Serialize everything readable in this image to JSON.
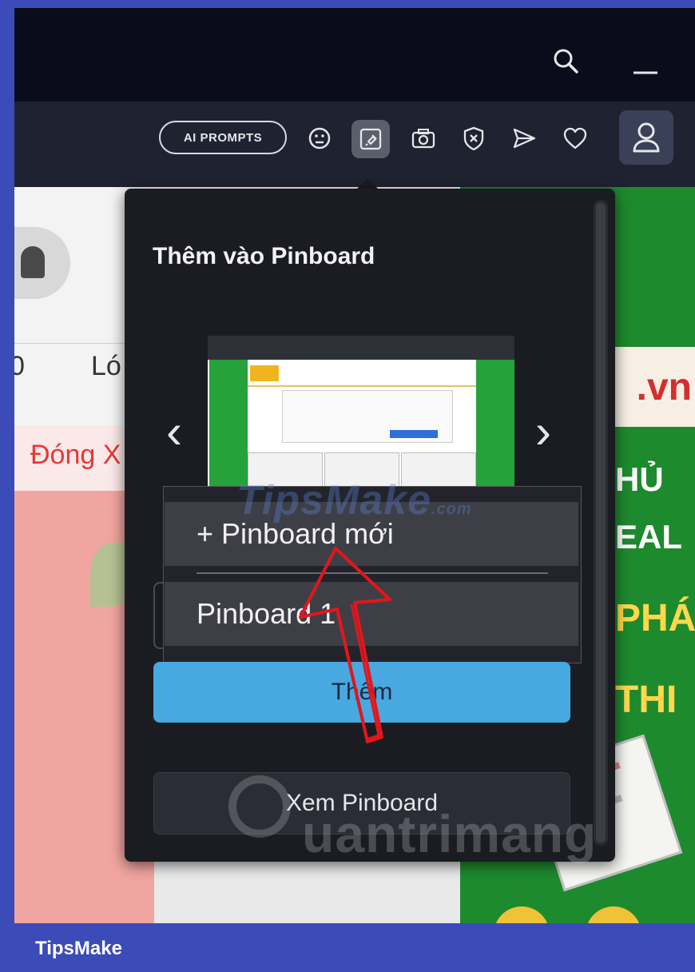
{
  "toolbar": {
    "ai_prompts_label": "AI PROMPTS",
    "icons": [
      "search-icon",
      "minimize-icon",
      "emoji-icon",
      "pin-icon",
      "camera-icon",
      "shield-icon",
      "send-icon",
      "heart-icon",
      "user-icon"
    ],
    "active_icon": "pin-icon"
  },
  "background": {
    "lo_text": "Ló",
    "zero_text": "0",
    "dong_text": "Đóng X",
    "vn_text": ".vn",
    "promo_1": "HỦ",
    "promo_2": "EAL",
    "promo_3": "PHÁ",
    "promo_4": "THI"
  },
  "popup": {
    "title": "Thêm vào Pinboard",
    "prev_arrow": "‹",
    "next_arrow": "›",
    "dropdown_items": [
      "+ Pinboard mới",
      "Pinboard 1"
    ],
    "add_button": "Thêm",
    "view_button": "Xem Pinboard"
  },
  "watermarks": {
    "tipsmake": "TipsMake",
    "tipsmake_suffix": ".com",
    "quantrimang": "uantrimang"
  },
  "footer": {
    "brand": "TipsMake"
  },
  "colors": {
    "accent_button": "#48a8e0",
    "popup_bg": "#1b1c22",
    "frame_border": "#3b4bb8",
    "annotation_arrow": "#e3161c"
  }
}
